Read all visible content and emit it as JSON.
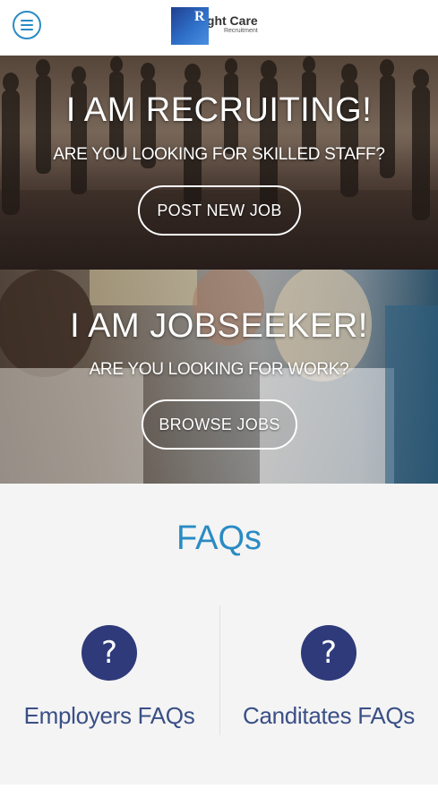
{
  "header": {
    "menu_icon": "hamburger-menu-icon",
    "logo": {
      "mark_letter": "R",
      "name": "ight Care",
      "tagline": "Recruitment"
    }
  },
  "recruiting": {
    "title": "I AM RECRUITING!",
    "subtitle": "ARE YOU LOOKING FOR SKILLED STAFF?",
    "button_label": "POST NEW JOB"
  },
  "jobseeker": {
    "title": "I AM JOBSEEKER!",
    "subtitle": "ARE YOU LOOKING FOR WORK?",
    "button_label": "BROWSE JOBS"
  },
  "faq": {
    "title": "FAQs",
    "items": [
      {
        "icon": "question-mark-icon",
        "symbol": "?",
        "label": "Employers FAQs"
      },
      {
        "icon": "question-mark-icon",
        "symbol": "?",
        "label": "Canditates FAQs"
      }
    ]
  },
  "colors": {
    "accent": "#2a8bc4",
    "faq_icon_bg": "#2e3a7a",
    "faq_label": "#3a4f86",
    "faq_bg": "#f4f4f4"
  }
}
